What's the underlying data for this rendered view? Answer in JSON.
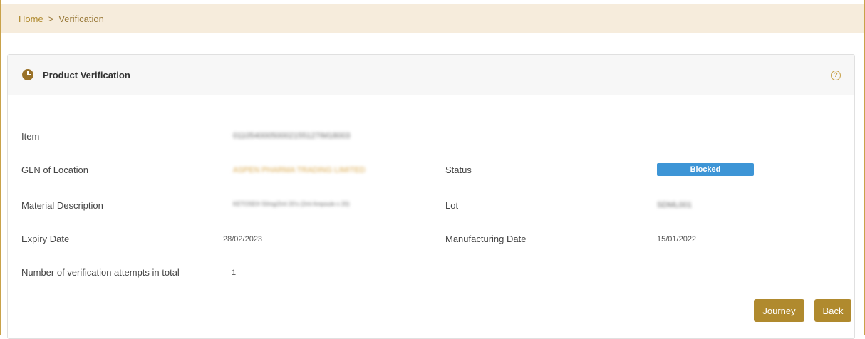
{
  "breadcrumb": {
    "home": "Home",
    "separator": ">",
    "current": "Verification"
  },
  "panel": {
    "title": "Product Verification",
    "clock_icon": "clock-icon",
    "help_icon": "help-circle-icon",
    "help_glyph": "?"
  },
  "fields": {
    "item_label": "Item",
    "item_value": "01105400050002155127IM18003",
    "gln_label": "GLN of Location",
    "gln_value": "ASPEN PHARMA TRADING LIMITED",
    "status_label": "Status",
    "status_value": "Blocked",
    "material_label": "Material Description",
    "material_value": "KETOSE® 50mg/2ml 20's (2ml Ampoule x 20)",
    "lot_label": "Lot",
    "lot_value": "SDML001",
    "expiry_label": "Expiry Date",
    "expiry_value": "28/02/2023",
    "manufacturing_label": "Manufacturing Date",
    "manufacturing_value": "15/01/2022",
    "attempts_label": "Number of verification attempts in total",
    "attempts_value": "1"
  },
  "buttons": {
    "journey": "Journey",
    "back": "Back"
  },
  "colors": {
    "accent": "#b08a2e",
    "breadcrumb_bg": "#f6ecdc",
    "status_blocked": "#3d95d6"
  }
}
